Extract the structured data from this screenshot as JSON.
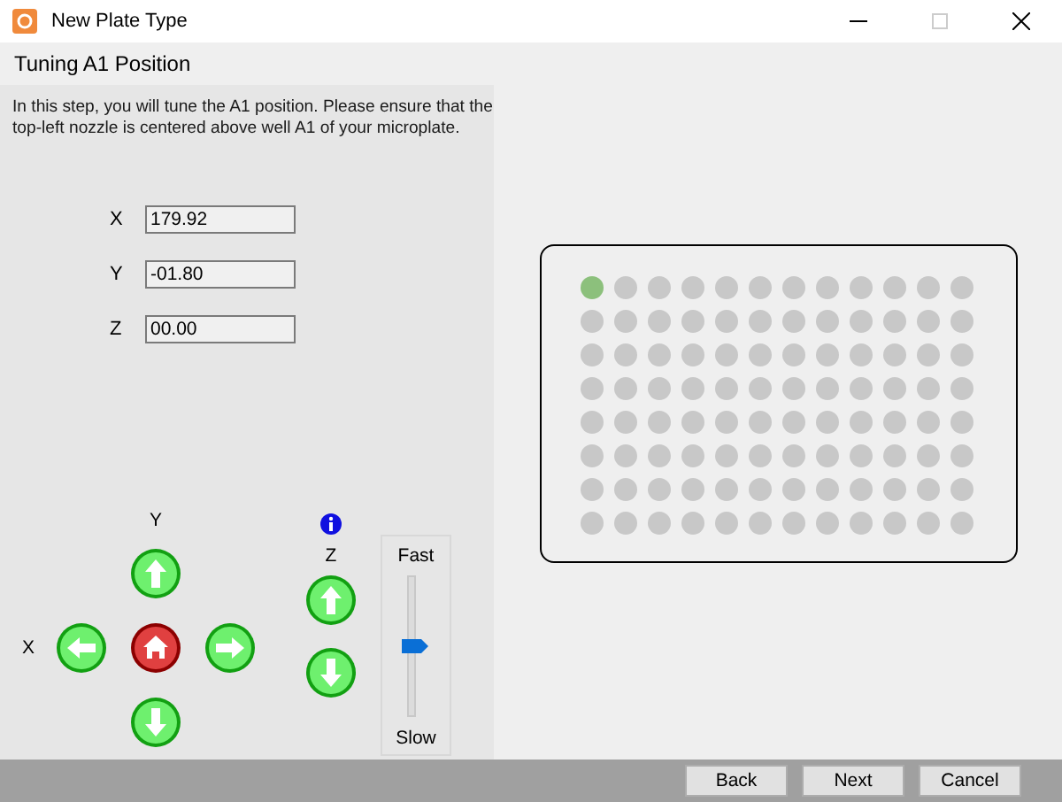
{
  "window": {
    "title": "New Plate Type"
  },
  "step": {
    "title": "Tuning A1 Position",
    "instructions": "In this step, you will tune the A1 position. Please ensure that the top-left nozzle is centered above well A1 of your microplate."
  },
  "position": [
    {
      "axis": "X",
      "value": "179.92"
    },
    {
      "axis": "Y",
      "value": "-01.80"
    },
    {
      "axis": "Z",
      "value": "00.00"
    }
  ],
  "jog": {
    "y_label": "Y",
    "x_label": "X",
    "z_label": "Z"
  },
  "speed": {
    "fast_label": "Fast",
    "slow_label": "Slow",
    "level": 0.5
  },
  "plate": {
    "rows": [
      [
        {
          "selected": true
        },
        {
          "selected": false
        },
        {
          "selected": false
        },
        {
          "selected": false
        },
        {
          "selected": false
        },
        {
          "selected": false
        },
        {
          "selected": false
        },
        {
          "selected": false
        },
        {
          "selected": false
        },
        {
          "selected": false
        },
        {
          "selected": false
        },
        {
          "selected": false
        }
      ],
      [
        {
          "selected": false
        },
        {
          "selected": false
        },
        {
          "selected": false
        },
        {
          "selected": false
        },
        {
          "selected": false
        },
        {
          "selected": false
        },
        {
          "selected": false
        },
        {
          "selected": false
        },
        {
          "selected": false
        },
        {
          "selected": false
        },
        {
          "selected": false
        },
        {
          "selected": false
        }
      ],
      [
        {
          "selected": false
        },
        {
          "selected": false
        },
        {
          "selected": false
        },
        {
          "selected": false
        },
        {
          "selected": false
        },
        {
          "selected": false
        },
        {
          "selected": false
        },
        {
          "selected": false
        },
        {
          "selected": false
        },
        {
          "selected": false
        },
        {
          "selected": false
        },
        {
          "selected": false
        }
      ],
      [
        {
          "selected": false
        },
        {
          "selected": false
        },
        {
          "selected": false
        },
        {
          "selected": false
        },
        {
          "selected": false
        },
        {
          "selected": false
        },
        {
          "selected": false
        },
        {
          "selected": false
        },
        {
          "selected": false
        },
        {
          "selected": false
        },
        {
          "selected": false
        },
        {
          "selected": false
        }
      ],
      [
        {
          "selected": false
        },
        {
          "selected": false
        },
        {
          "selected": false
        },
        {
          "selected": false
        },
        {
          "selected": false
        },
        {
          "selected": false
        },
        {
          "selected": false
        },
        {
          "selected": false
        },
        {
          "selected": false
        },
        {
          "selected": false
        },
        {
          "selected": false
        },
        {
          "selected": false
        }
      ],
      [
        {
          "selected": false
        },
        {
          "selected": false
        },
        {
          "selected": false
        },
        {
          "selected": false
        },
        {
          "selected": false
        },
        {
          "selected": false
        },
        {
          "selected": false
        },
        {
          "selected": false
        },
        {
          "selected": false
        },
        {
          "selected": false
        },
        {
          "selected": false
        },
        {
          "selected": false
        }
      ],
      [
        {
          "selected": false
        },
        {
          "selected": false
        },
        {
          "selected": false
        },
        {
          "selected": false
        },
        {
          "selected": false
        },
        {
          "selected": false
        },
        {
          "selected": false
        },
        {
          "selected": false
        },
        {
          "selected": false
        },
        {
          "selected": false
        },
        {
          "selected": false
        },
        {
          "selected": false
        }
      ],
      [
        {
          "selected": false
        },
        {
          "selected": false
        },
        {
          "selected": false
        },
        {
          "selected": false
        },
        {
          "selected": false
        },
        {
          "selected": false
        },
        {
          "selected": false
        },
        {
          "selected": false
        },
        {
          "selected": false
        },
        {
          "selected": false
        },
        {
          "selected": false
        },
        {
          "selected": false
        }
      ]
    ]
  },
  "buttons": [
    "Back",
    "Next",
    "Cancel"
  ]
}
